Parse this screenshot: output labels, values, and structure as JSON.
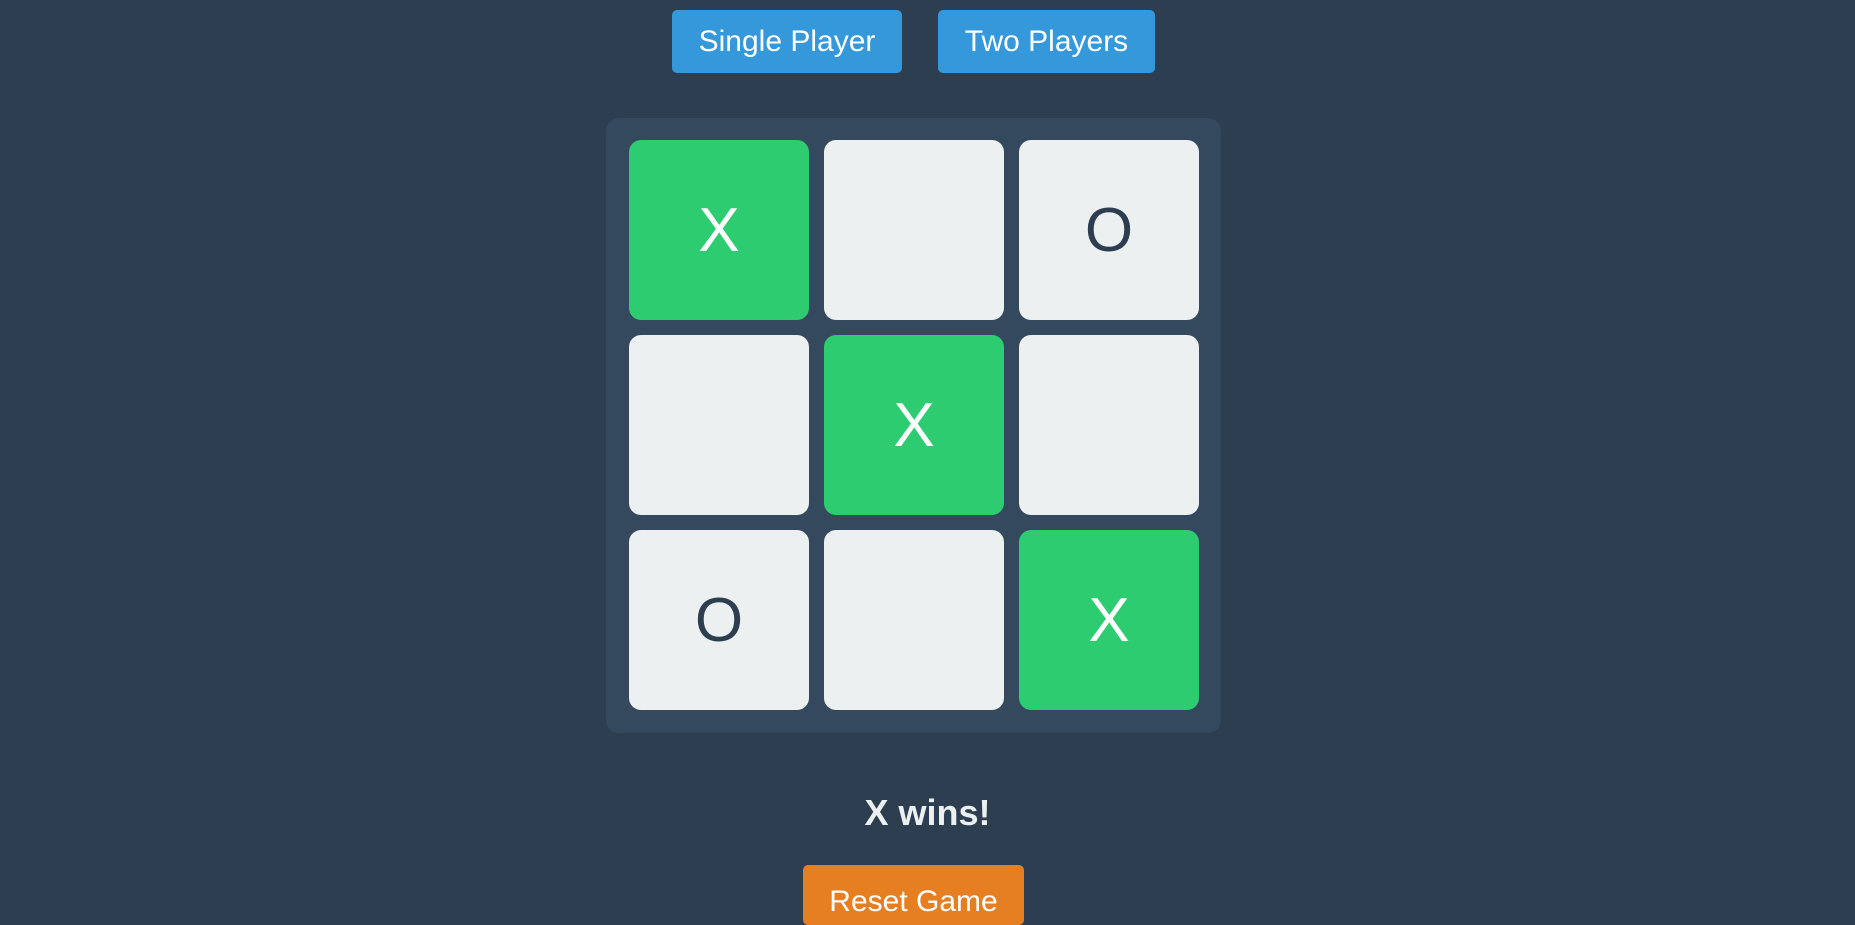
{
  "mode_buttons": {
    "single_player_label": "Single Player",
    "two_players_label": "Two Players"
  },
  "board": {
    "cells": [
      "X",
      "",
      "O",
      "",
      "X",
      "",
      "O",
      "",
      "X"
    ],
    "winning_cells": [
      0,
      4,
      8
    ]
  },
  "status": {
    "text": "X wins!"
  },
  "reset": {
    "label": "Reset Game"
  },
  "colors": {
    "background": "#2c3e50",
    "board": "#34495e",
    "cell": "#ecf0f1",
    "win_cell": "#2ecc71",
    "mode_button": "#3498db",
    "reset_button": "#e67e22"
  }
}
